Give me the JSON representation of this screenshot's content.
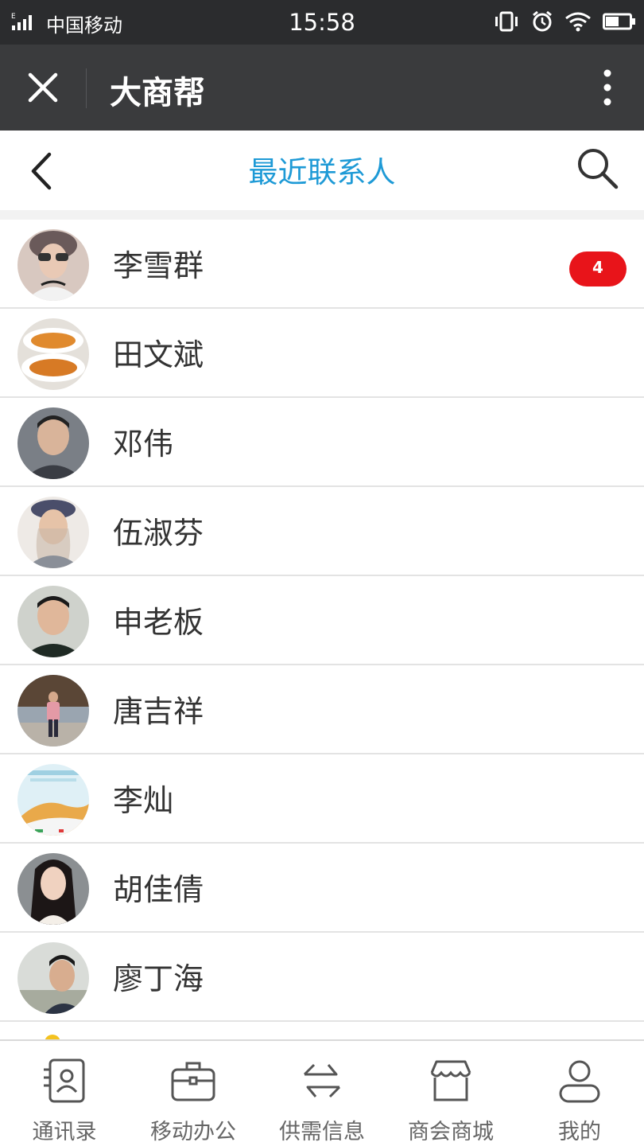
{
  "status_bar": {
    "carrier": "中国移动",
    "time": "15:58"
  },
  "app_bar": {
    "title": "大商帮"
  },
  "page_header": {
    "title": "最近联系人"
  },
  "contacts": [
    {
      "name": "李雪群",
      "unread": "4",
      "avatar": "woman-sunglasses-photo"
    },
    {
      "name": "田文斌",
      "unread": "",
      "avatar": "food-plates-photo"
    },
    {
      "name": "邓伟",
      "unread": "",
      "avatar": "man-portrait-photo"
    },
    {
      "name": "伍淑芬",
      "unread": "",
      "avatar": "woman-hat-photo"
    },
    {
      "name": "申老板",
      "unread": "",
      "avatar": "man-jacket-photo"
    },
    {
      "name": "唐吉祥",
      "unread": "",
      "avatar": "man-outdoor-photo"
    },
    {
      "name": "李灿",
      "unread": "",
      "avatar": "poster-image"
    },
    {
      "name": "胡佳倩",
      "unread": "",
      "avatar": "woman-long-hair-photo"
    },
    {
      "name": "廖丁海",
      "unread": "",
      "avatar": "man-selfie-photo"
    }
  ],
  "bottom_nav": [
    {
      "label": "通讯录",
      "icon": "contacts-icon"
    },
    {
      "label": "移动办公",
      "icon": "briefcase-icon"
    },
    {
      "label": "供需信息",
      "icon": "exchange-icon"
    },
    {
      "label": "商会商城",
      "icon": "store-icon"
    },
    {
      "label": "我的",
      "icon": "profile-icon"
    }
  ],
  "colors": {
    "accent": "#1e9ad6",
    "badge": "#e8141a",
    "app_bar": "#3a3b3d",
    "status_bar": "#2b2c2e"
  }
}
